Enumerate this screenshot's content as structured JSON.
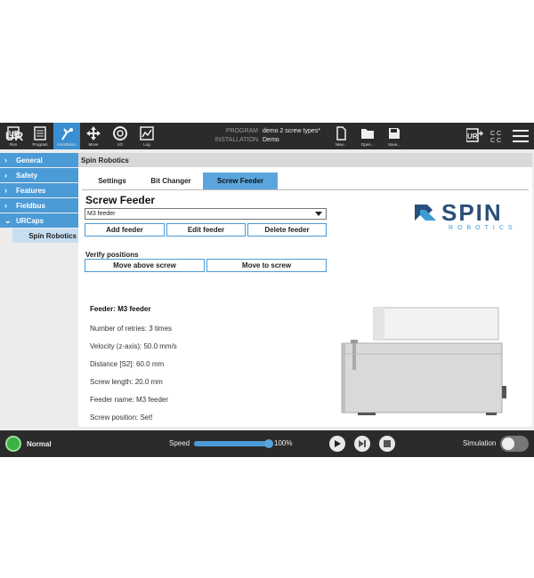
{
  "topbar": {
    "buttons": [
      {
        "label": "Run",
        "icon": "run-icon"
      },
      {
        "label": "Program",
        "icon": "program-icon"
      },
      {
        "label": "Installation",
        "icon": "installation-icon"
      },
      {
        "label": "Move",
        "icon": "move-icon"
      },
      {
        "label": "I/O",
        "icon": "io-icon"
      },
      {
        "label": "Log",
        "icon": "log-icon"
      }
    ],
    "program_key": "PROGRAM",
    "program_value": "demo 2 screw types*",
    "installation_key": "INSTALLATION",
    "installation_value": "Demo",
    "file_buttons": [
      "New...",
      "Open...",
      "Save..."
    ],
    "active_color": "#3a8fd0"
  },
  "nav": {
    "items": [
      "General",
      "Safety",
      "Features",
      "Fieldbus",
      "URCaps"
    ],
    "sub_item": "Spin Robotics"
  },
  "content": {
    "header": "Spin Robotics",
    "tabs": [
      "Settings",
      "Bit Changer",
      "Screw Feeder"
    ],
    "active_tab": "Screw Feeder",
    "title": "Screw Feeder",
    "feeder_select": "M3 feeder",
    "buttons": {
      "add": "Add feeder",
      "edit": "Edit feeder",
      "delete": "Delete feeder"
    },
    "verify_label": "Verify positions",
    "verify_buttons": {
      "above": "Move above screw",
      "to": "Move to screw"
    },
    "brand": {
      "name": "SPIN",
      "sub": "ROBOTICS",
      "color": "#2a4f7a",
      "accent": "#3a9bd6"
    },
    "feeder_info": {
      "heading": "Feeder: M3 feeder",
      "retries": "Number of retries:  3 times",
      "velocity": "Velocity (z-axis):  50.0 mm/s",
      "distance": "Distance [S2]:  60.0 mm",
      "length": "Screw length:  20.0 mm",
      "name": "Feeder name:  M3 feeder",
      "position": "Screw position:  Set!"
    }
  },
  "bottombar": {
    "status": "Normal",
    "speed_label": "Speed",
    "speed_value": "100%",
    "speed_fraction": 1.0,
    "simulation_label": "Simulation",
    "status_color": "#3cb043"
  }
}
